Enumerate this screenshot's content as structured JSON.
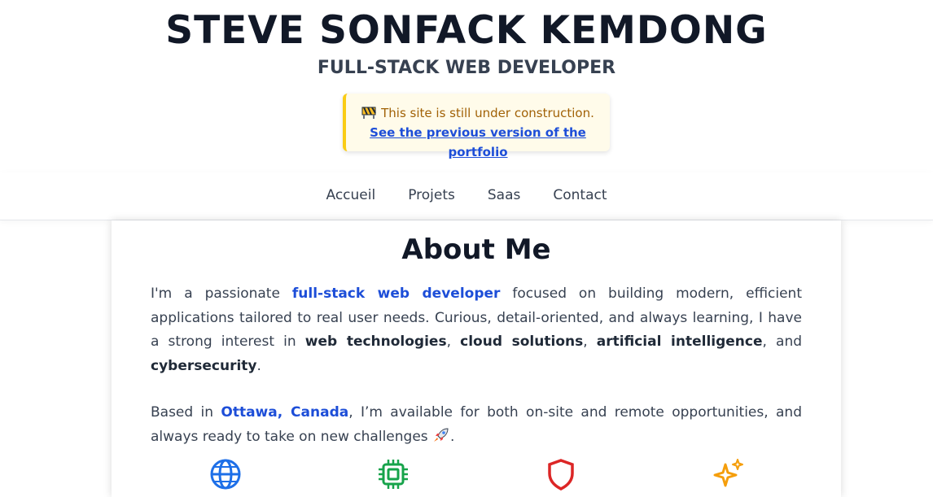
{
  "header": {
    "name": "STEVE SONFACK KEMDONG",
    "role": "FULL-STACK WEB DEVELOPER"
  },
  "notice": {
    "icon": "construction-icon",
    "message": "This site is still under construction.",
    "link_label": "See the previous version of the portfolio"
  },
  "nav": {
    "items": [
      "Accueil",
      "Projets",
      "Saas",
      "Contact"
    ]
  },
  "about": {
    "title": "About Me",
    "p1_intro": "I'm a passionate ",
    "p1_role": "full-stack web developer",
    "p1_mid": " focused on building modern, efficient applications tailored to real user needs. Curious, detail-oriented, and always learning, I have a strong interest in ",
    "p1_i1": "web technologies",
    "p1_sep1": ", ",
    "p1_i2": "cloud solutions",
    "p1_sep2": ", ",
    "p1_i3": "artificial intelligence",
    "p1_sep3": ", and ",
    "p1_i4": "cybersecurity",
    "p1_end": ".",
    "p2_intro": "Based in ",
    "p2_location": "Ottawa, Canada",
    "p2_rest": ", I’m available for both on-site and remote opportunities, and always ready to take on new challenges ",
    "p2_end": "."
  },
  "features": {
    "icons": [
      "globe-icon",
      "cpu-chip-icon",
      "shield-icon",
      "sparkles-icon"
    ],
    "colors": {
      "globe": "#1d6fe8",
      "chip": "#16a34a",
      "shield": "#dc2626",
      "sparkles": "#f59e0b"
    }
  },
  "colors": {
    "accent_blue": "#1d4ed8",
    "notice_bg": "#fffbea",
    "notice_border": "#facc15",
    "notice_text": "#a16207"
  }
}
